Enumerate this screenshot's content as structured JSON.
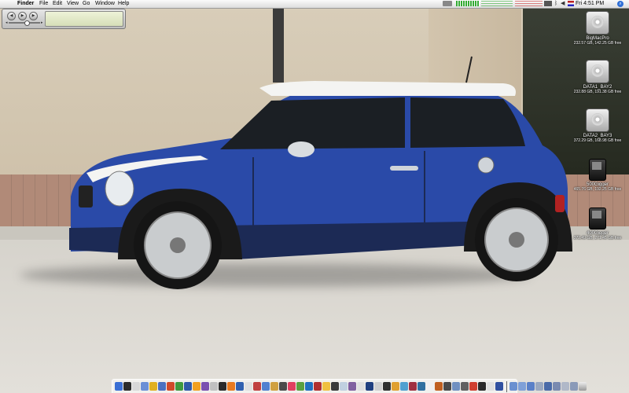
{
  "menubar": {
    "apple_glyph": "",
    "app_name": "Finder",
    "menus": [
      "File",
      "Edit",
      "View",
      "Go",
      "Window",
      "Help"
    ],
    "clock": "Fri 4:51 PM"
  },
  "itunes": {
    "lcd_glyph": ""
  },
  "desktop": {
    "volumes": [
      {
        "name": "BigMacPro",
        "info": "232.57 GB, 142.25 GB free",
        "type": "drive"
      },
      {
        "name": "DATA1_BAY2",
        "info": "232.88 GB, 191.38 GB free",
        "type": "drive"
      },
      {
        "name": "DATA2_BAY3",
        "info": "372.29 GB, 168.98 GB free",
        "type": "drive"
      },
      {
        "name": "500Gigger",
        "info": "465.76 GB, 192.25 GB free",
        "type": "ipod"
      },
      {
        "name": "400Gigger",
        "info": "372.49 GB, 271.45 GB free",
        "type": "ipod"
      }
    ]
  },
  "colors": {
    "car_body": "#2a4aa8",
    "car_roof": "#f4f4f2",
    "spotlight": "#2f6fd6"
  },
  "dock": {
    "app_colors": [
      "#3b6fd4",
      "#2b2b2b",
      "#d8d8d8",
      "#6a8fd6",
      "#e0b020",
      "#4a70c0",
      "#d04a2a",
      "#3f9a3f",
      "#2f5aa8",
      "#f0a020",
      "#7a4fb0",
      "#c0c0c0",
      "#2a2a2a",
      "#e87a20",
      "#3060b0",
      "#e0e0e0",
      "#c04040",
      "#5080d0",
      "#d0a040",
      "#4a4a4a",
      "#e04060",
      "#5aa040",
      "#2070c0",
      "#b03030",
      "#f0c040",
      "#3a3a3a",
      "#c0d0e0",
      "#8060a0",
      "#e0e0e0",
      "#204080",
      "#d0d0d0",
      "#303030",
      "#e0a030",
      "#50a0d0",
      "#a03040",
      "#3070a0",
      "#f0f0f0",
      "#c06020",
      "#4a4a4a",
      "#7090c0",
      "#606060",
      "#d04030",
      "#2a2a2a",
      "#e0e0e0",
      "#3050a0"
    ],
    "folder_colors": [
      "#6a90d0",
      "#7fa0d8",
      "#5a80c8",
      "#9aa8c0",
      "#4a6aa8",
      "#7a8ab0",
      "#b0b8c8",
      "#8a9ab8"
    ]
  }
}
